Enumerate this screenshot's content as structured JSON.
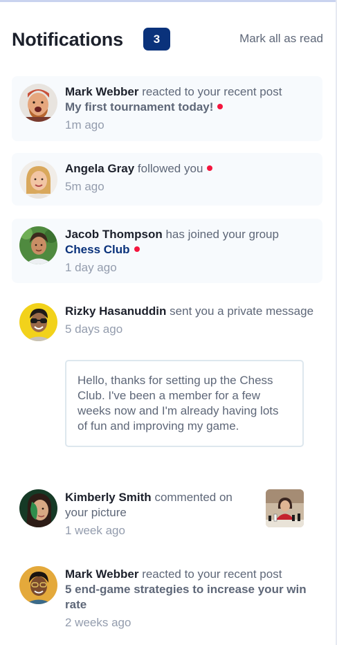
{
  "header": {
    "title": "Notifications",
    "unread_count": "3",
    "mark_all_label": "Mark all as read"
  },
  "colors": {
    "brand_blue": "#0a327b",
    "unread_dot": "#f4163e",
    "unread_background": "#f7fafd",
    "text_dark": "#1c202b",
    "text_muted": "#5e6778",
    "text_time": "#939cad"
  },
  "notifications": [
    {
      "name": "Mark Webber",
      "action": "reacted to your recent post",
      "post": "My first tournament today!",
      "time": "1m ago",
      "unread": true,
      "avatar": "avatar-mark-webber"
    },
    {
      "name": "Angela Gray",
      "action": "followed you",
      "time": "5m ago",
      "unread": true,
      "avatar": "avatar-angela-gray"
    },
    {
      "name": "Jacob Thompson",
      "action": "has joined your group",
      "group": "Chess Club",
      "time": "1 day ago",
      "unread": true,
      "avatar": "avatar-jacob-thompson"
    },
    {
      "name": "Rizky Hasanuddin",
      "action": "sent you a private message",
      "time": "5 days ago",
      "unread": false,
      "message": "Hello, thanks for setting up the Chess Club. I've been a member for a few weeks now and I'm already having lots of fun and improving my game.",
      "avatar": "avatar-rizky-hasanuddin"
    },
    {
      "name": "Kimberly Smith",
      "action": "commented on your picture",
      "time": "1 week ago",
      "unread": false,
      "picture": "chess-picture-thumbnail",
      "avatar": "avatar-kimberly-smith"
    },
    {
      "name": "Mark Webber",
      "action": "reacted to your recent post",
      "post": "5 end-game strategies to increase your win rate",
      "time": "2 weeks ago",
      "unread": false,
      "avatar": "avatar-nathan-peterson"
    }
  ]
}
